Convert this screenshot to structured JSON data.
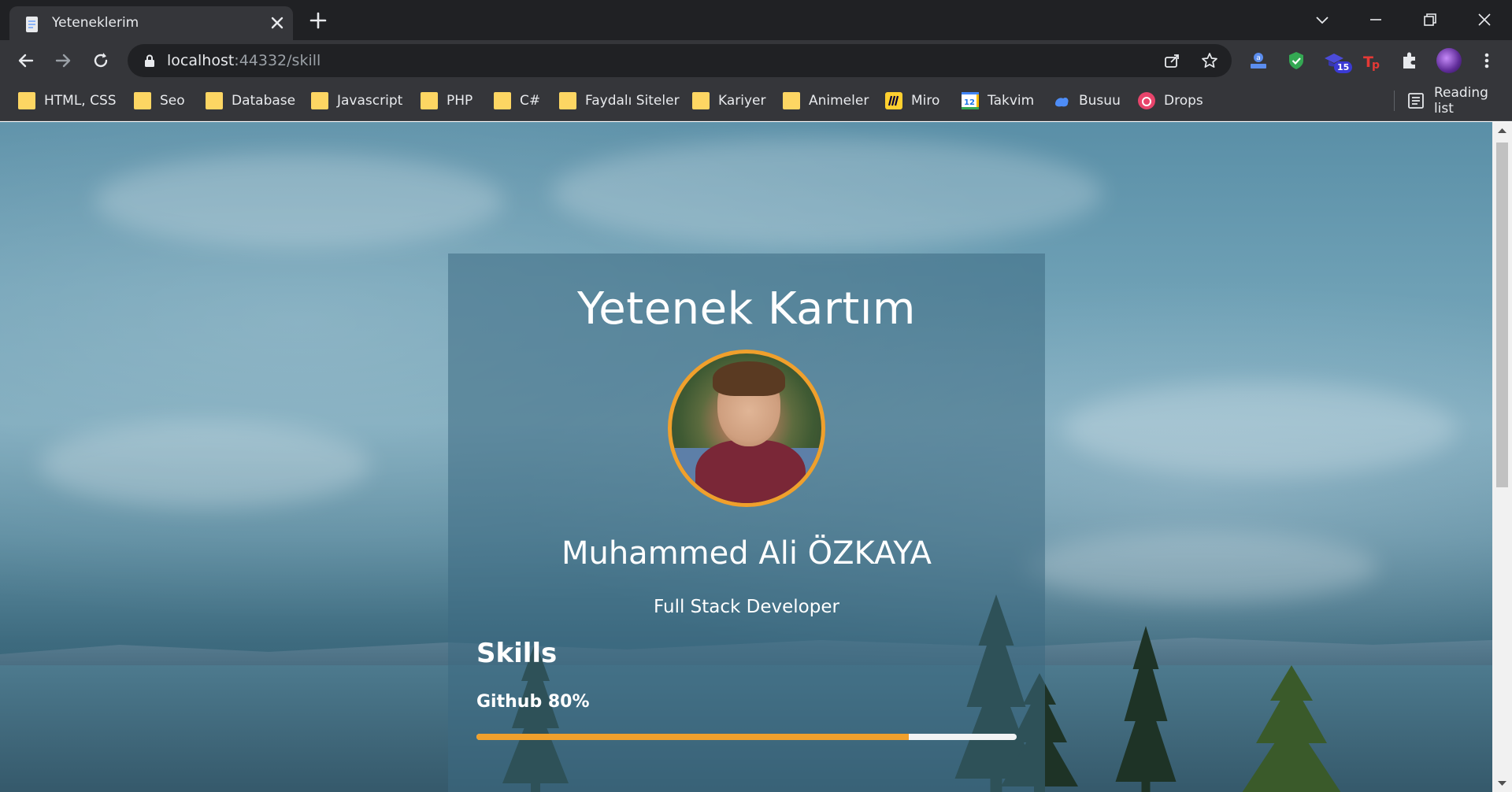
{
  "browser": {
    "tab_title": "Yeteneklerim",
    "url_host": "localhost",
    "url_rest": ":44332/skill",
    "extension_badge": "15",
    "reading_list_label": "Reading list"
  },
  "bookmarks": [
    {
      "label": "HTML, CSS",
      "icon": "folder-icon"
    },
    {
      "label": "Seo",
      "icon": "folder-icon"
    },
    {
      "label": "Database",
      "icon": "folder-icon"
    },
    {
      "label": "Javascript",
      "icon": "folder-icon"
    },
    {
      "label": "PHP",
      "icon": "folder-icon"
    },
    {
      "label": "C#",
      "icon": "folder-icon"
    },
    {
      "label": "Faydalı Siteler",
      "icon": "folder-icon"
    },
    {
      "label": "Kariyer",
      "icon": "folder-icon"
    },
    {
      "label": "Animeler",
      "icon": "folder-icon"
    },
    {
      "label": "Miro",
      "icon": "miro-icon"
    },
    {
      "label": "Takvim",
      "icon": "calendar-icon"
    },
    {
      "label": "Busuu",
      "icon": "busuu-icon"
    },
    {
      "label": "Drops",
      "icon": "drops-icon"
    }
  ],
  "calendar_day": "12",
  "card": {
    "title": "Yetenek Kartım",
    "name": "Muhammed Ali ÖZKAYA",
    "role": "Full Stack Developer",
    "skills_heading": "Skills",
    "skills": [
      {
        "label": "Github 80%",
        "percent": 80
      }
    ]
  },
  "colors": {
    "accent": "#f0a02c",
    "browser_dark": "#202124",
    "browser_toolbar": "#35363a"
  }
}
